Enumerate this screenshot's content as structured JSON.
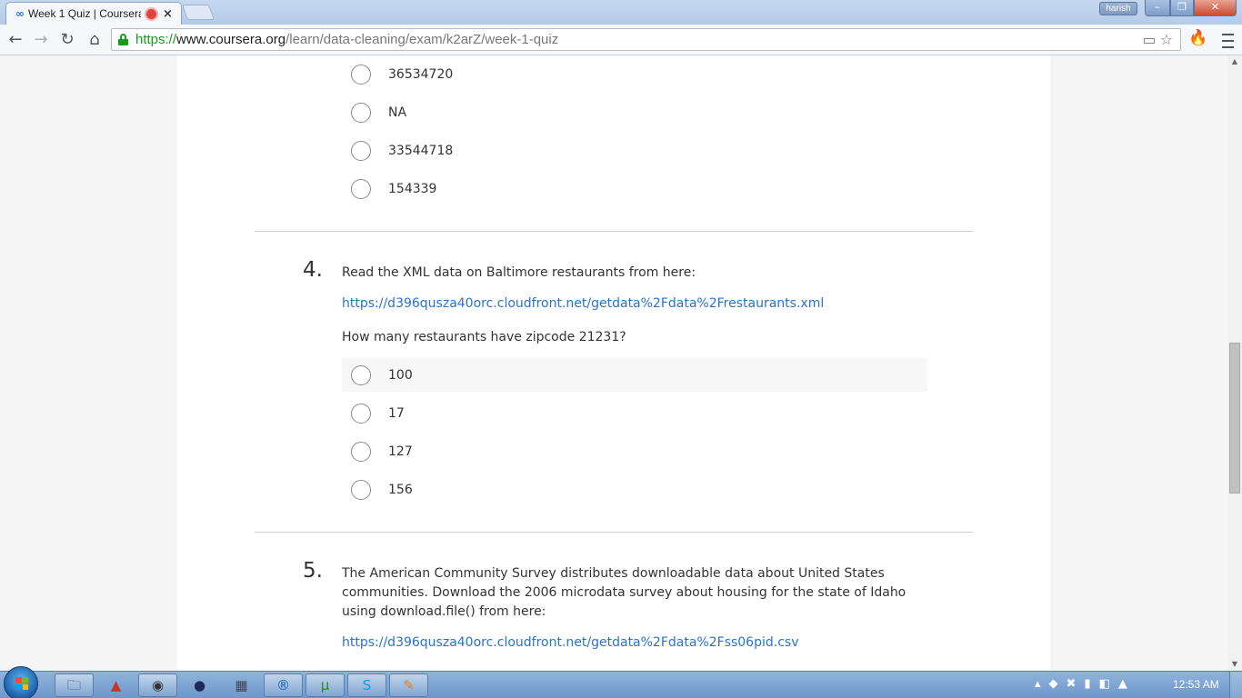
{
  "browser": {
    "tab_title": "Week 1 Quiz | Coursera",
    "tab_favicon": "∞",
    "close_glyph": "×",
    "user_name": "harish",
    "url_scheme": "https://",
    "url_host": "www.coursera.org",
    "url_path": "/learn/data-cleaning/exam/k2arZ/week-1-quiz"
  },
  "quiz": {
    "q3_options": [
      "36534720",
      "NA",
      "33544718",
      "154339"
    ],
    "q4": {
      "number": "4.",
      "text": "Read the XML data on Baltimore restaurants from here:",
      "link": "https://d396qusza40orc.cloudfront.net/getdata%2Fdata%2Frestaurants.xml",
      "question": "How many restaurants have zipcode 21231?",
      "options": [
        "100",
        "17",
        "127",
        "156"
      ]
    },
    "q5": {
      "number": "5.",
      "text": "The American Community Survey distributes downloadable data about United States communities. Download the 2006 microdata survey about housing for the state of Idaho using download.file() from here:",
      "link": "https://d396qusza40orc.cloudfront.net/getdata%2Fdata%2Fss06pid.csv"
    }
  },
  "taskbar": {
    "clock": "12:53 AM"
  },
  "colors": {
    "link": "#2a73cc",
    "secure_green": "#179c1d"
  }
}
